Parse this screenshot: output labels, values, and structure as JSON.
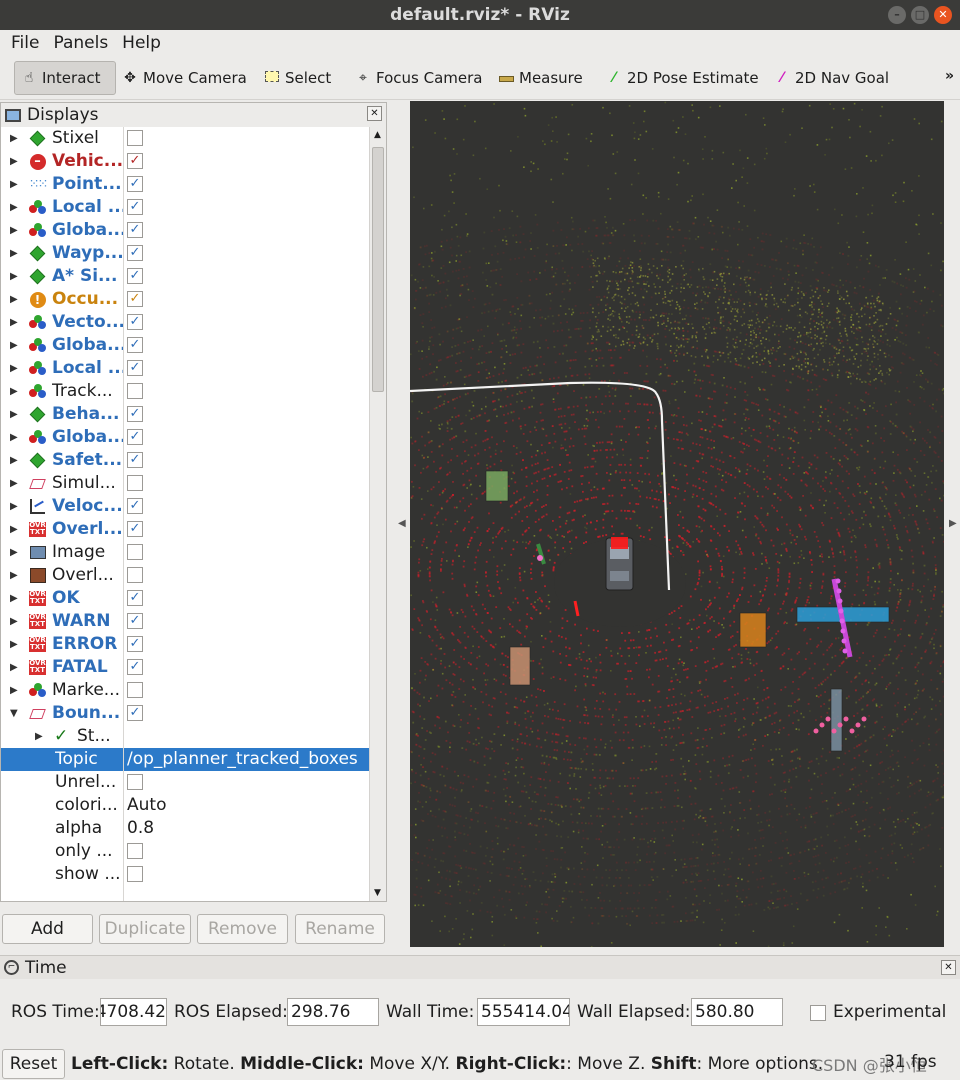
{
  "window": {
    "title": "default.rviz* - RViz"
  },
  "menu": [
    "File",
    "Panels",
    "Help"
  ],
  "toolbar": {
    "tools": [
      {
        "label": "Interact",
        "icon": "hand-cursor-icon"
      },
      {
        "label": "Move Camera",
        "icon": "move-camera-icon"
      },
      {
        "label": "Select",
        "icon": "select-box-icon"
      },
      {
        "label": "Focus Camera",
        "icon": "focus-camera-icon"
      },
      {
        "label": "Measure",
        "icon": "ruler-icon"
      },
      {
        "label": "2D Pose Estimate",
        "icon": "green-arrow-icon"
      },
      {
        "label": "2D Nav Goal",
        "icon": "magenta-arrow-icon"
      }
    ],
    "more": "»"
  },
  "displays": {
    "title": "Displays",
    "items": [
      {
        "label": "Stixel",
        "checked": false,
        "icon": "green-cube-icon",
        "style": "normal"
      },
      {
        "label": "Vehic...",
        "checked": true,
        "icon": "error-icon",
        "style": "red"
      },
      {
        "label": "Point...",
        "checked": true,
        "icon": "pointcloud-icon",
        "style": "blue"
      },
      {
        "label": "Local ...",
        "checked": true,
        "icon": "marker-array-icon",
        "style": "blue"
      },
      {
        "label": "Globa...",
        "checked": true,
        "icon": "marker-array-icon",
        "style": "blue"
      },
      {
        "label": "Wayp...",
        "checked": true,
        "icon": "green-cube-icon",
        "style": "blue"
      },
      {
        "label": "A* Si...",
        "checked": true,
        "icon": "green-cube-icon",
        "style": "blue"
      },
      {
        "label": "Occu...",
        "checked": true,
        "icon": "warning-icon",
        "style": "orange"
      },
      {
        "label": "Vecto...",
        "checked": true,
        "icon": "marker-array-icon",
        "style": "blue"
      },
      {
        "label": "Globa...",
        "checked": true,
        "icon": "marker-array-icon",
        "style": "blue"
      },
      {
        "label": "Local ...",
        "checked": true,
        "icon": "marker-array-icon",
        "style": "blue"
      },
      {
        "label": "Track...",
        "checked": false,
        "icon": "marker-array-icon",
        "style": "normal"
      },
      {
        "label": "Beha...",
        "checked": true,
        "icon": "green-cube-icon",
        "style": "blue"
      },
      {
        "label": "Globa...",
        "checked": true,
        "icon": "marker-array-icon",
        "style": "blue"
      },
      {
        "label": "Safet...",
        "checked": true,
        "icon": "green-cube-icon",
        "style": "blue"
      },
      {
        "label": "Simul...",
        "checked": false,
        "icon": "bounding-box-icon",
        "style": "normal"
      },
      {
        "label": "Veloc...",
        "checked": true,
        "icon": "plot-icon",
        "style": "blue"
      },
      {
        "label": "Overl...",
        "checked": true,
        "icon": "text-overlay-icon",
        "style": "blue"
      },
      {
        "label": "Image",
        "checked": false,
        "icon": "image-icon",
        "style": "normal"
      },
      {
        "label": "Overl...",
        "checked": false,
        "icon": "picture-icon",
        "style": "normal"
      },
      {
        "label": "OK",
        "checked": true,
        "icon": "text-overlay-icon",
        "style": "blue"
      },
      {
        "label": "WARN",
        "checked": true,
        "icon": "text-overlay-icon",
        "style": "blue"
      },
      {
        "label": "ERROR",
        "checked": true,
        "icon": "text-overlay-icon",
        "style": "blue"
      },
      {
        "label": "FATAL",
        "checked": true,
        "icon": "text-overlay-icon",
        "style": "blue"
      },
      {
        "label": "Marke...",
        "checked": false,
        "icon": "marker-array-icon",
        "style": "normal"
      },
      {
        "label": "Boun...",
        "checked": true,
        "icon": "bounding-box-icon",
        "style": "blue",
        "expanded": true
      }
    ],
    "props": [
      {
        "label": "St...",
        "value": "",
        "status": "✓"
      },
      {
        "label": "Topic",
        "value": "/op_planner_tracked_boxes",
        "selected": true
      },
      {
        "label": "Unrel...",
        "checkbox": true,
        "checked": false
      },
      {
        "label": "colori...",
        "value": "Auto"
      },
      {
        "label": "alpha",
        "value": "0.8"
      },
      {
        "label": "only ...",
        "checkbox": true,
        "checked": false
      },
      {
        "label": "show ...",
        "checkbox": true,
        "checked": false
      }
    ],
    "buttons": {
      "add": "Add",
      "duplicate": "Duplicate",
      "remove": "Remove",
      "rename": "Rename"
    }
  },
  "time": {
    "title": "Time",
    "ros_time_label": "ROS Time:",
    "ros_time": "4708.42",
    "ros_elapsed_label": "ROS Elapsed:",
    "ros_elapsed": "298.76",
    "wall_time_label": "Wall Time:",
    "wall_time": "555414.04",
    "wall_elapsed_label": "Wall Elapsed:",
    "wall_elapsed": "580.80",
    "experimental_label": "Experimental"
  },
  "status": {
    "reset": "Reset",
    "hint_parts": [
      {
        "b": "Left-Click:",
        "t": " Rotate. "
      },
      {
        "b": "Middle-Click:",
        "t": " Move X/Y. "
      },
      {
        "b": "Right-Click:",
        "t": ": Move Z. "
      },
      {
        "b": "Shift",
        "t": ": More options."
      }
    ],
    "fps": "31 fps",
    "watermark": "CSDN @张小恒"
  },
  "colors": {
    "accent": "#2c7ac9",
    "viewport_bg": "#333331",
    "path": "#f4f4f4",
    "lidar": "#c8202a"
  }
}
